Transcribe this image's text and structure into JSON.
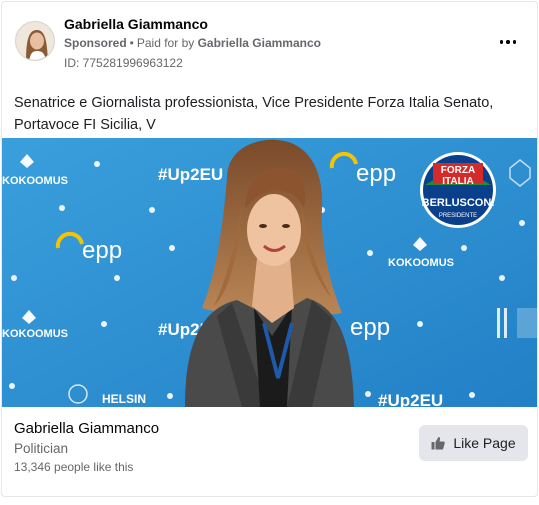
{
  "post": {
    "page_name": "Gabriella Giammanco",
    "sponsored_label": "Sponsored",
    "separator": "•",
    "paid_for_prefix": "Paid for by",
    "paid_for_name": "Gabriella Giammanco",
    "ad_id": "ID: 775281996963122",
    "body_text": "Senatrice e Giornalista professionista, Vice Presidente Forza Italia Senato, Portavoce FI Sicilia, V"
  },
  "creative": {
    "backdrop_texts": {
      "kokoomus": "KOKOOMUS",
      "up2eu": "#Up2EU",
      "epp": "epp",
      "helsinki": "HELSIN"
    },
    "logo": {
      "top": "FORZA",
      "middle": "ITALIA",
      "name": "BERLUSCONI",
      "sub": "PRESIDENTE"
    }
  },
  "footer": {
    "page_name": "Gabriella Giammanco",
    "category": "Politician",
    "likes": "13,346 people like this",
    "like_button_label": "Like Page"
  },
  "colors": {
    "backdrop": "#2c8fd1",
    "like_button_bg": "#e4e6eb",
    "secondary_text": "#65676b"
  },
  "icons": {
    "more": "more-horizontal-icon",
    "like": "thumbs-up-icon"
  }
}
